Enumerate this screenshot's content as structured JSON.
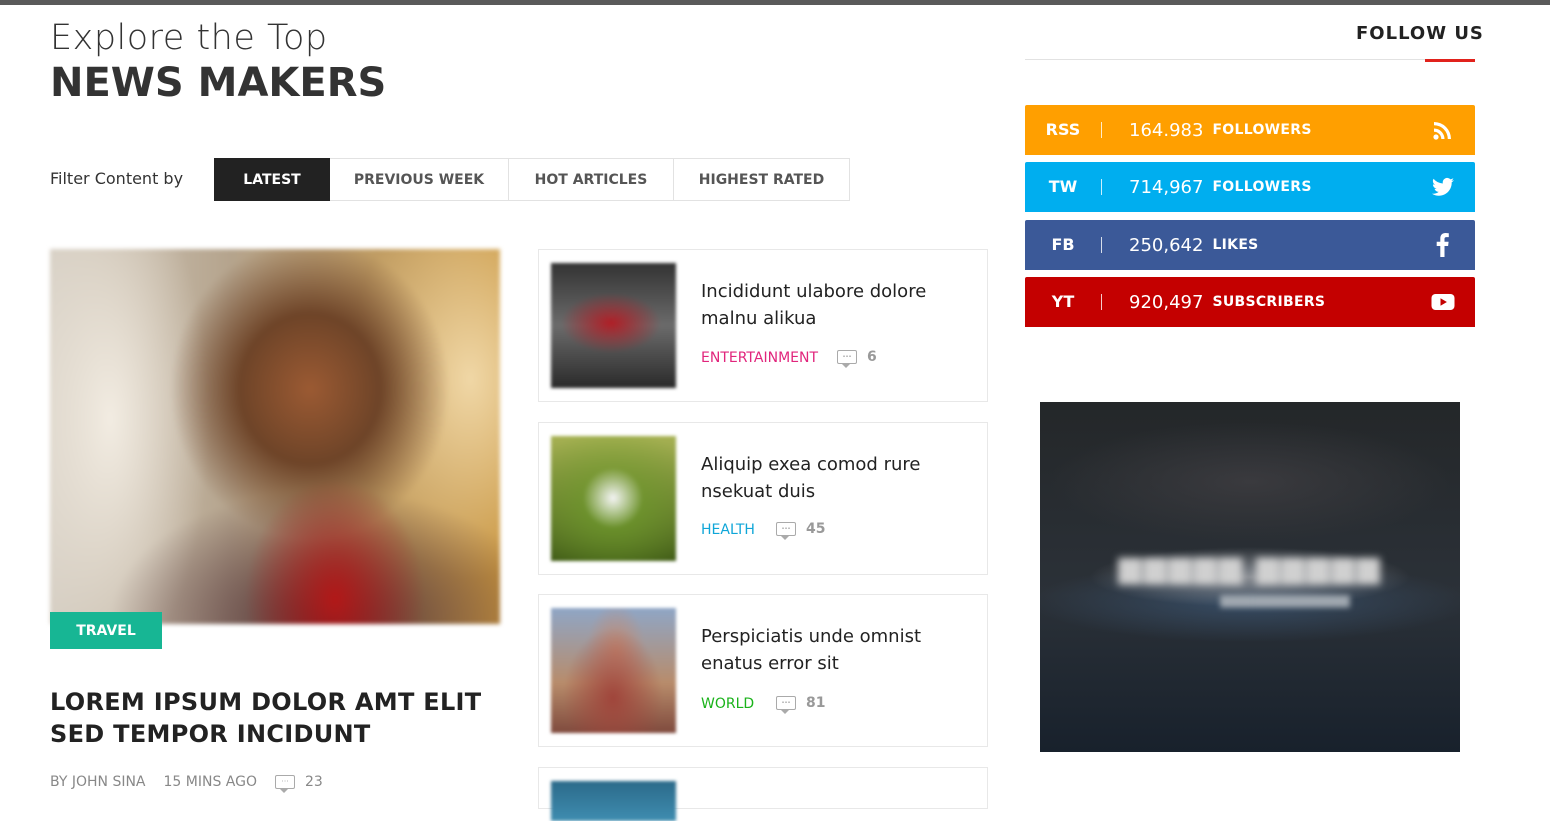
{
  "heading": {
    "line1": "Explore the Top",
    "line2": "NEWS MAKERS"
  },
  "filter": {
    "label": "Filter Content by",
    "tabs": [
      "LATEST",
      "PREVIOUS WEEK",
      "HOT ARTICLES",
      "HIGHEST RATED"
    ],
    "active": "LATEST"
  },
  "featured": {
    "category": "TRAVEL",
    "category_color": "#17b694",
    "title": "LOREM IPSUM DOLOR AMT ELIT SED TEMPOR INCIDUNT",
    "author": "BY JOHN SINA",
    "time": "15 MINS AGO",
    "comments": "23"
  },
  "articles": [
    {
      "title": "Incididunt ulabore dolore malnu alikua",
      "category": "ENTERTAINMENT",
      "category_color": "#e1257c",
      "comments": "6"
    },
    {
      "title": "Aliquip exea comod rure nsekuat duis",
      "category": "HEALTH",
      "category_color": "#0fa6d8",
      "comments": "45"
    },
    {
      "title": "Perspiciatis unde omnist enatus error sit",
      "category": "WORLD",
      "category_color": "#1bb31b",
      "comments": "81"
    }
  ],
  "follow": {
    "title": "FOLLOW US",
    "accent_color": "#e1221c",
    "networks": [
      {
        "abbr": "RSS",
        "count": "164.983",
        "label": "FOLLOWERS",
        "color": "#ff9f00",
        "icon": "rss-icon"
      },
      {
        "abbr": "TW",
        "count": "714,967",
        "label": "FOLLOWERS",
        "color": "#00aeef",
        "icon": "twitter-icon"
      },
      {
        "abbr": "FB",
        "count": "250,642",
        "label": "LIKES",
        "color": "#3b5998",
        "icon": "facebook-icon"
      },
      {
        "abbr": "YT",
        "count": "920,497",
        "label": "SUBSCRIBERS",
        "color": "#c40000",
        "icon": "youtube-icon"
      }
    ]
  }
}
